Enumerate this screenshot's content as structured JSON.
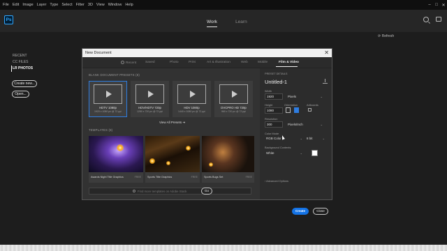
{
  "menubar": {
    "items": [
      "File",
      "Edit",
      "Image",
      "Layer",
      "Type",
      "Select",
      "Filter",
      "3D",
      "View",
      "Window",
      "Help"
    ],
    "controls": [
      "–",
      "□",
      "✕"
    ]
  },
  "app": {
    "logo": "Ps",
    "nav": [
      {
        "label": "Work",
        "active": true
      },
      {
        "label": "Learn",
        "active": false
      }
    ],
    "refresh": "Refresh"
  },
  "sidebar": {
    "items": [
      {
        "label": "RECENT",
        "active": false
      },
      {
        "label": "CC FILES",
        "active": false
      },
      {
        "label": "LR PHOTOS",
        "active": true
      }
    ],
    "create_new": "Create new...",
    "open": "Open..."
  },
  "dialog": {
    "title": "New Document",
    "close": "✕",
    "tabs": [
      {
        "label": "Recent",
        "active": false
      },
      {
        "label": "Saved",
        "active": false
      },
      {
        "label": "Photo",
        "active": false
      },
      {
        "label": "Print",
        "active": false
      },
      {
        "label": "Art & Illustration",
        "active": false
      },
      {
        "label": "Web",
        "active": false
      },
      {
        "label": "Mobile",
        "active": false
      },
      {
        "label": "Film & Video",
        "active": true
      }
    ],
    "presets_label": "BLANK DOCUMENT PRESETS",
    "presets_count": "(8)",
    "presets": [
      {
        "name": "HDTV 1080p",
        "dims": "1920 x 1080 px @ 72 ppi",
        "selected": true
      },
      {
        "name": "HDV/HDTV 720p",
        "dims": "1280 x 720 px @ 72 ppi",
        "selected": false
      },
      {
        "name": "HDV 1080p",
        "dims": "1440 x 1080 px @ 72 ppi",
        "selected": false
      },
      {
        "name": "DVCPRO HD 720p",
        "dims": "960 x 720 px @ 72 ppi",
        "selected": false
      }
    ],
    "view_all": "View All Presets",
    "templates_label": "TEMPLATES",
    "templates_count": "(8)",
    "templates": [
      {
        "name": "Awards Night Title Graphics",
        "badge": "FREE"
      },
      {
        "name": "Sports Title Graphics",
        "badge": "FREE"
      },
      {
        "name": "Sports Bugs Set",
        "badge": "FREE"
      }
    ],
    "template_search_placeholder": "Find more templates on Adobe Stock",
    "go": "Go"
  },
  "details": {
    "header": "PRESET DETAILS",
    "doc_name": "Untitled-1",
    "width_label": "Width",
    "width_value": "1920",
    "width_unit": "Pixels",
    "height_label": "Height",
    "height_value": "1080",
    "orientation_label": "Orientation",
    "artboards_label": "Artboards",
    "resolution_label": "Resolution",
    "resolution_value": "300",
    "resolution_unit": "Pixels/Inch",
    "color_mode_label": "Color Mode",
    "color_mode_value": "RGB Color",
    "bit_depth": "8 bit",
    "background_label": "Background Contents",
    "background_value": "White",
    "advanced": "Advanced Options",
    "create": "Create",
    "close": "Close"
  },
  "colors": {
    "accent": "#1473e6",
    "selected_border": "#2e7de1",
    "dialog_bg": "#323232",
    "workspace_bg": "#1d1d1d"
  }
}
